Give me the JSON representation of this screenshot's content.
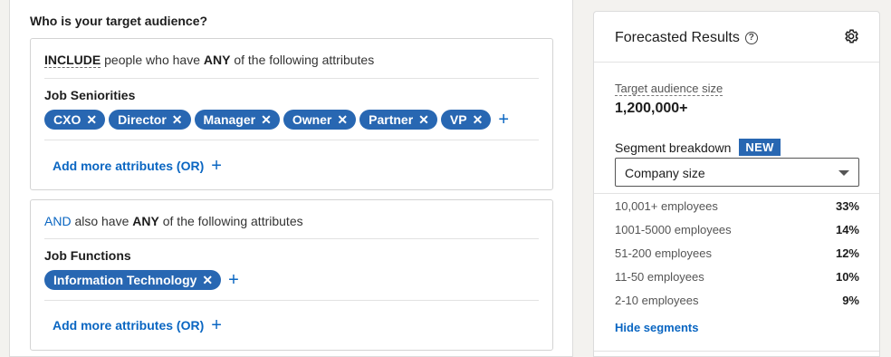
{
  "audience_heading": "Who is your target audience?",
  "include_box": {
    "keyword": "INCLUDE",
    "rule_middle": " people who have ",
    "any": "ANY",
    "rule_end": " of the following attributes",
    "attribute_title": "Job Seniorities",
    "pills": [
      "CXO",
      "Director",
      "Manager",
      "Owner",
      "Partner",
      "VP"
    ],
    "add_more": "Add more attributes (OR)"
  },
  "and_box": {
    "keyword": "AND",
    "rule_middle": " also have ",
    "any": "ANY",
    "rule_end": " of the following attributes",
    "attribute_title": "Job Functions",
    "pills": [
      "Information Technology"
    ],
    "add_more": "Add more attributes (OR)"
  },
  "forecast": {
    "title": "Forecasted Results",
    "target_label": "Target audience size",
    "target_value": "1,200,000+",
    "segment_label": "Segment breakdown",
    "new_badge": "NEW",
    "select_value": "Company size",
    "segments": [
      {
        "label": "10,001+ employees",
        "pct": "33%"
      },
      {
        "label": "1001-5000 employees",
        "pct": "14%"
      },
      {
        "label": "51-200 employees",
        "pct": "12%"
      },
      {
        "label": "11-50 employees",
        "pct": "10%"
      },
      {
        "label": "2-10 employees",
        "pct": "9%"
      }
    ],
    "hide_segments": "Hide segments"
  },
  "icons": {
    "remove": "close-icon",
    "add": "plus-icon",
    "help": "question-circle-icon",
    "settings": "gear-icon",
    "dropdown": "caret-down-icon"
  },
  "colors": {
    "accent": "#0a66c2",
    "pill_bg": "#2867b2"
  }
}
